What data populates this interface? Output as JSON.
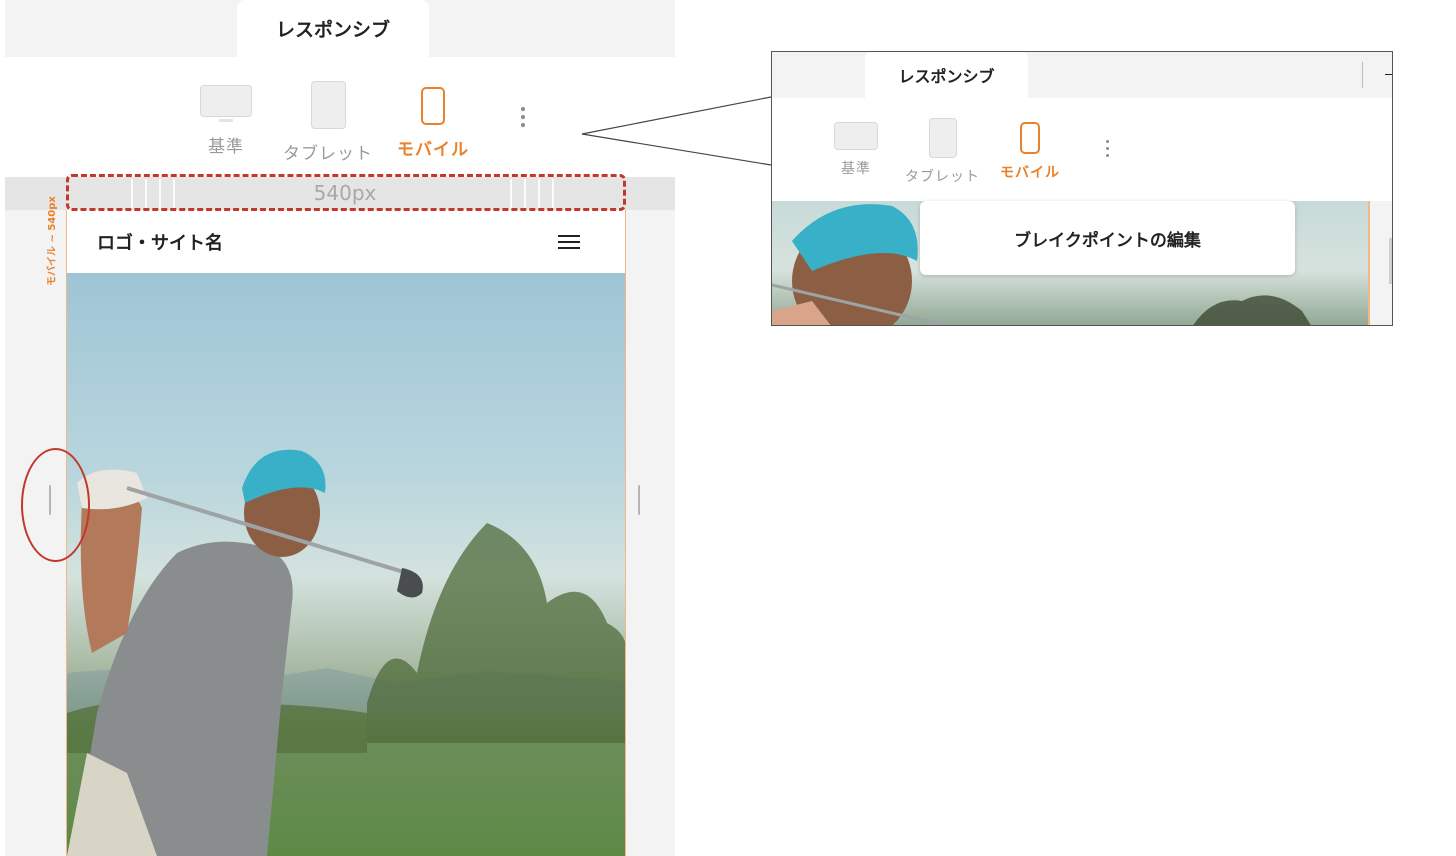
{
  "left_panel": {
    "tab_label": "レスポンシブ",
    "devices": [
      {
        "label": "基準",
        "icon": "desktop-icon",
        "active": false
      },
      {
        "label": "タブレット",
        "icon": "tablet-icon",
        "active": false
      },
      {
        "label": "モバイル",
        "icon": "mobile-icon",
        "active": true
      }
    ],
    "more_icon": "vertical-dots-icon",
    "ruler_width_label": "540px",
    "breakpoint_vertical_label": "モバイル ~ 540px",
    "site": {
      "logo_text": "ロゴ・サイト名",
      "menu_icon": "hamburger-icon"
    }
  },
  "callout": {
    "tab_label": "レスポンシブ",
    "devices": [
      {
        "label": "基準",
        "icon": "desktop-icon",
        "active": false
      },
      {
        "label": "タブレット",
        "icon": "tablet-icon",
        "active": false
      },
      {
        "label": "モバイル",
        "icon": "mobile-icon",
        "active": true
      }
    ],
    "more_icon": "vertical-dots-icon",
    "tooltip_text": "ブレイクポイントの編集"
  },
  "colors": {
    "accent": "#e8822c",
    "annotation": "#c0392b",
    "inactive_text": "#9a9a9a"
  }
}
